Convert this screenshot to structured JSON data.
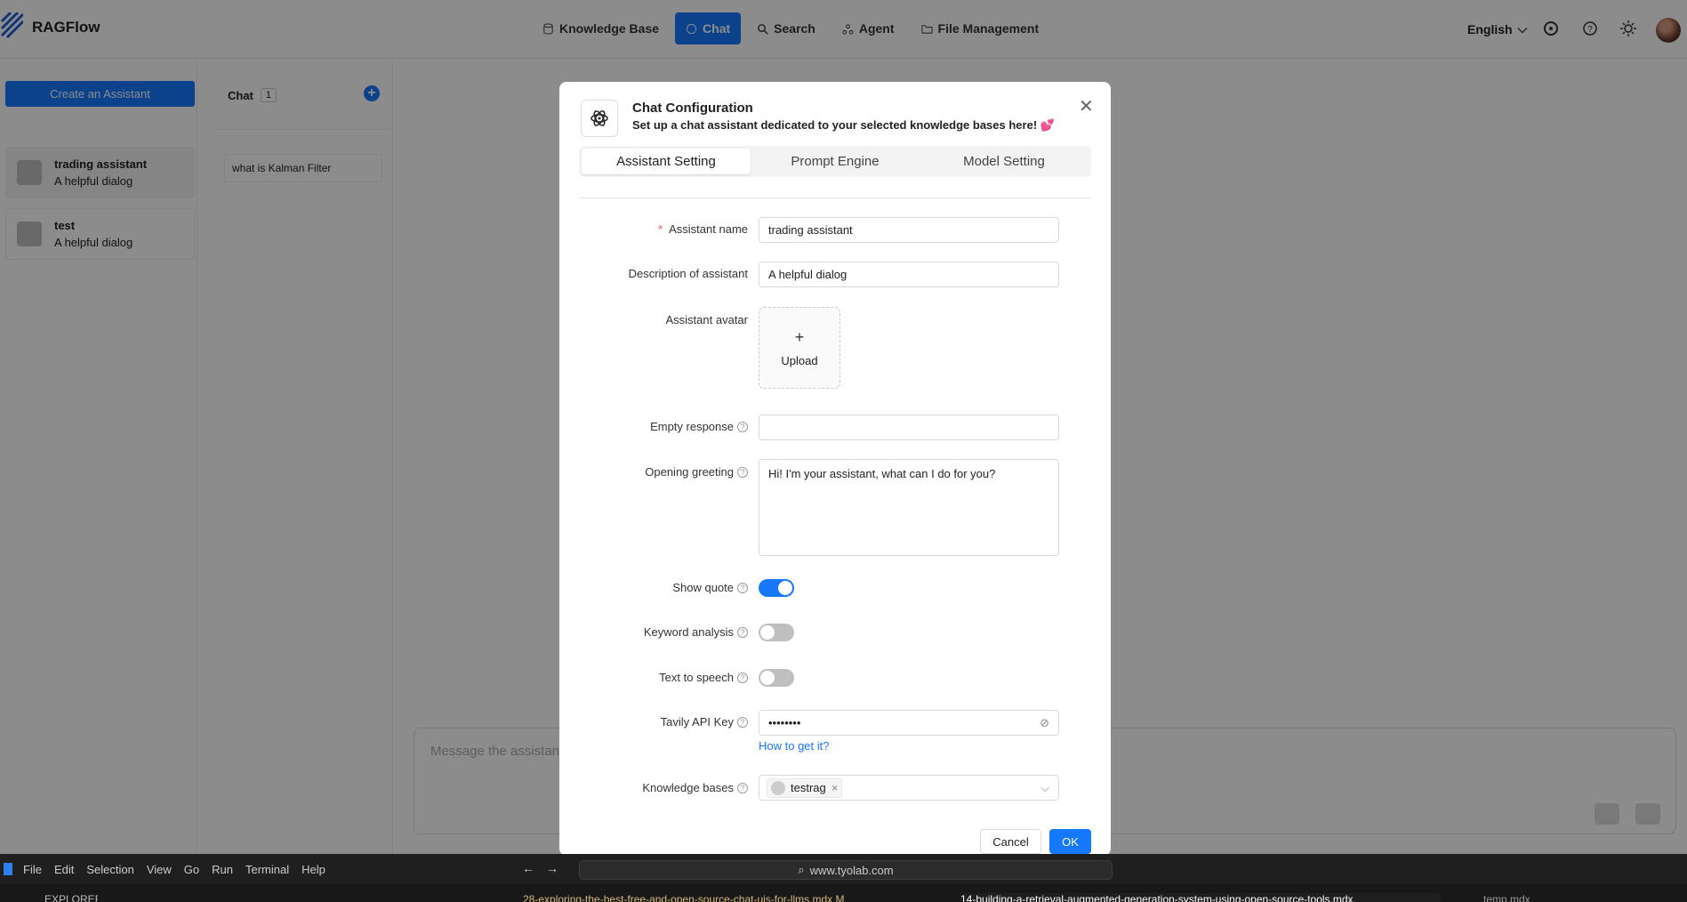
{
  "app": {
    "name": "RAGFlow"
  },
  "nav": {
    "items": [
      {
        "label": "Knowledge Base",
        "icon": "database-icon",
        "active": false
      },
      {
        "label": "Chat",
        "icon": "chat-bubble-icon",
        "active": true
      },
      {
        "label": "Search",
        "icon": "search-icon",
        "active": false
      },
      {
        "label": "Agent",
        "icon": "agent-icon",
        "active": false
      },
      {
        "label": "File Management",
        "icon": "folder-icon",
        "active": false
      }
    ],
    "language": "English"
  },
  "sidebar": {
    "create_label": "Create an Assistant",
    "assistants": [
      {
        "name": "trading assistant",
        "description": "A helpful dialog"
      },
      {
        "name": "test",
        "description": "A helpful dialog"
      }
    ]
  },
  "chat_list": {
    "title": "Chat",
    "count": "1",
    "items": [
      "what is Kalman Filter"
    ]
  },
  "message": {
    "placeholder": "Message the assistant..."
  },
  "modal": {
    "title": "Chat Configuration",
    "subtitle": "Set up a chat assistant dedicated to your selected knowledge bases here! 💕",
    "tabs": [
      "Assistant Setting",
      "Prompt Engine",
      "Model Setting"
    ],
    "fields": {
      "assistant_name_label": "Assistant name",
      "assistant_name_value": "trading assistant",
      "description_label": "Description of assistant",
      "description_value": "A helpful dialog",
      "avatar_label": "Assistant avatar",
      "upload_label": "Upload",
      "empty_response_label": "Empty response",
      "empty_response_value": "",
      "opening_greeting_label": "Opening greeting",
      "opening_greeting_value": "Hi! I'm your assistant, what can I do for you?",
      "show_quote_label": "Show quote",
      "keyword_analysis_label": "Keyword analysis",
      "tts_label": "Text to speech",
      "tavily_label": "Tavily API Key",
      "tavily_value": "••••••••",
      "tavily_link": "How to get it?",
      "kb_label": "Knowledge bases",
      "kb_tag": "testrag"
    },
    "toggles": {
      "show_quote": true,
      "keyword_analysis": false,
      "text_to_speech": false
    },
    "cancel_label": "Cancel",
    "ok_label": "OK"
  },
  "vscode": {
    "menu": [
      "File",
      "Edit",
      "Selection",
      "View",
      "Go",
      "Run",
      "Terminal",
      "Help"
    ],
    "address": "www.tyolab.com",
    "explorer_label": "EXPLORER",
    "tabs": [
      "28-exploring-the-best-free-and-open-source-chat-uis-for-llms.mdx M",
      "14-building-a-retrieval-augmented-generation-system-using-open-source-tools.mdx",
      "temp.mdx"
    ]
  }
}
